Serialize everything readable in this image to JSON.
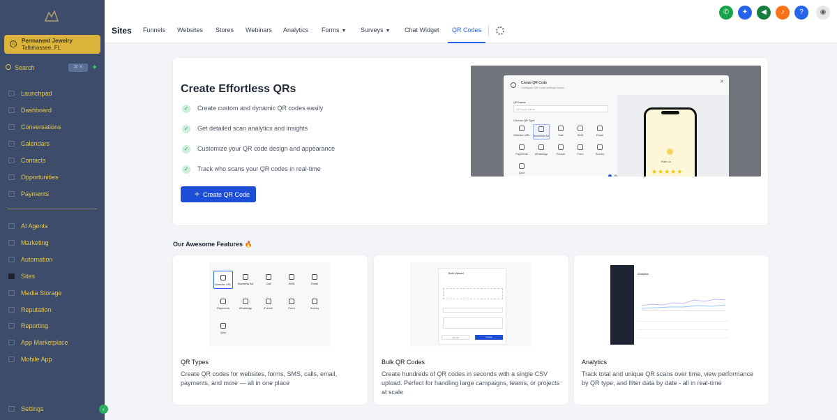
{
  "sidebar": {
    "account": {
      "name": "Permanent Jewelry",
      "location": "Tallahassee, FL"
    },
    "search": {
      "label": "Search",
      "shortcut": "⌘ K"
    },
    "items": [
      {
        "label": "Launchpad",
        "icon": "rocket-icon"
      },
      {
        "label": "Dashboard",
        "icon": "dashboard-icon"
      },
      {
        "label": "Conversations",
        "icon": "chat-icon"
      },
      {
        "label": "Calendars",
        "icon": "calendar-icon"
      },
      {
        "label": "Contacts",
        "icon": "contacts-icon"
      },
      {
        "label": "Opportunities",
        "icon": "funnel-icon"
      },
      {
        "label": "Payments",
        "icon": "payments-icon"
      },
      {
        "label": "AI Agents",
        "icon": "ai-icon"
      },
      {
        "label": "Marketing",
        "icon": "megaphone-icon"
      },
      {
        "label": "Automation",
        "icon": "automation-icon"
      },
      {
        "label": "Sites",
        "icon": "sites-icon"
      },
      {
        "label": "Media Storage",
        "icon": "media-icon"
      },
      {
        "label": "Reputation",
        "icon": "star-icon"
      },
      {
        "label": "Reporting",
        "icon": "chart-icon"
      },
      {
        "label": "App Marketplace",
        "icon": "grid-icon"
      },
      {
        "label": "Mobile App",
        "icon": "mobile-icon"
      }
    ],
    "settings": "Settings",
    "active": "Sites"
  },
  "topnav": {
    "title": "Sites",
    "tabs": [
      {
        "label": "Funnels"
      },
      {
        "label": "Websites"
      },
      {
        "label": "Stores"
      },
      {
        "label": "Webinars"
      },
      {
        "label": "Analytics"
      },
      {
        "label": "Forms",
        "dropdown": true
      },
      {
        "label": "Surveys",
        "dropdown": true
      },
      {
        "label": "Chat Widget"
      },
      {
        "label": "QR Codes",
        "active": true
      }
    ],
    "icons": [
      {
        "name": "phone-icon",
        "color": "#16a34a",
        "glyph": "✆"
      },
      {
        "name": "sparkle-icon",
        "color": "#2563eb",
        "glyph": "✦"
      },
      {
        "name": "megaphone-icon",
        "color": "#15803d",
        "glyph": "◀"
      },
      {
        "name": "bell-icon",
        "color": "#f97316",
        "glyph": "♪"
      },
      {
        "name": "help-icon",
        "color": "#2563eb",
        "glyph": "?"
      },
      {
        "name": "avatar-icon",
        "color": "#e5e7eb",
        "glyph": "◉"
      }
    ]
  },
  "hero": {
    "title": "Create Effortless QRs",
    "bullets": [
      "Create custom and dynamic QR codes easily",
      "Get detailed scan analytics and insights",
      "Customize your QR code design and appearance",
      "Track who scans your QR codes in real-time"
    ],
    "button": "Create QR Code",
    "preview": {
      "modal_title": "Create QR Code",
      "modal_subtitle": "Configure QR Code settings below",
      "name_label": "QR Name",
      "name_placeholder": "QR code name",
      "type_label": "Choose QR Type",
      "types": [
        "Website URL",
        "Business Ad",
        "Call",
        "SMS",
        "Email",
        "Payments",
        "WhatsApp",
        "Funnel",
        "Form",
        "Survey",
        "Quiz"
      ],
      "phone_text": "Rate us"
    }
  },
  "features": {
    "heading": "Our Awesome Features 🔥",
    "cards": [
      {
        "title": "QR Types",
        "desc": "Create QR codes for websites, forms, SMS, calls, email, payments, and more — all in one place",
        "options": [
          "Website URL",
          "Business Ad",
          "Call",
          "SMS",
          "Email",
          "Payments",
          "WhatsApp",
          "Funnel",
          "Form",
          "Survey",
          "Quiz"
        ]
      },
      {
        "title": "Bulk QR Codes",
        "desc": "Create hundreds of QR codes in seconds with a single CSV upload. Perfect for handling large campaigns, teams, or projects at scale",
        "modal": {
          "title": "Bulk Upload",
          "cancel": "Cancel",
          "create": "Create"
        }
      },
      {
        "title": "Analytics",
        "desc": "Track total and unique QR scans over time, view performance by QR type, and filter data by date - all in real-time",
        "screen_title": "Analytics"
      }
    ]
  }
}
